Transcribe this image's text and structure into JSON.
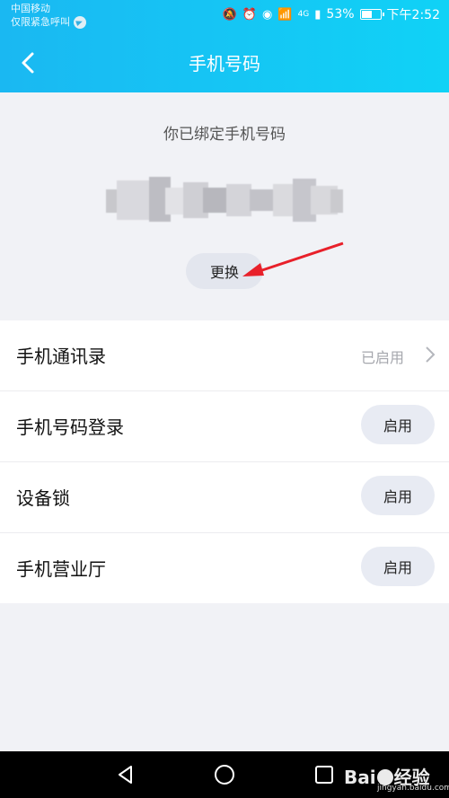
{
  "status_bar": {
    "carrier": "中国移动",
    "emergency": "仅限紧急呼叫",
    "network": "4G",
    "battery": "53%",
    "time": "下午2:52"
  },
  "header": {
    "title": "手机号码"
  },
  "binding": {
    "label": "你已绑定手机号码",
    "change_button": "更换"
  },
  "list": {
    "items": [
      {
        "label": "手机通讯录",
        "status": "已启用"
      },
      {
        "label": "手机号码登录",
        "button": "启用"
      },
      {
        "label": "设备锁",
        "button": "启用"
      },
      {
        "label": "手机营业厅",
        "button": "启用"
      }
    ]
  },
  "watermark": {
    "brand": "Bai",
    "brand2": "经验",
    "url": "jingyan.baidu.com"
  }
}
